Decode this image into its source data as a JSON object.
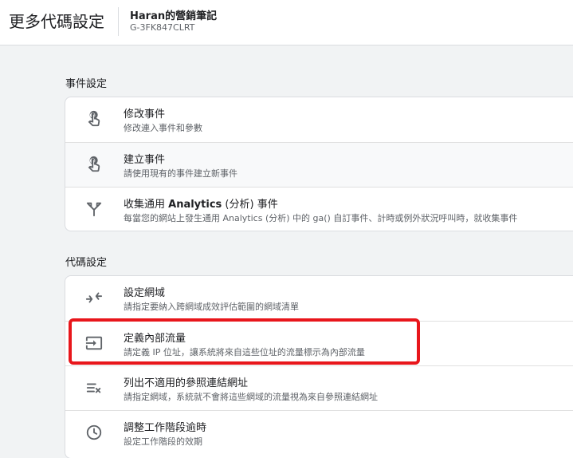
{
  "header": {
    "title": "更多代碼設定",
    "property_name": "Haran的營銷筆記",
    "property_id": "G-3FK847CLRT"
  },
  "sections": [
    {
      "title": "事件設定",
      "items": [
        {
          "title": "修改事件",
          "description": "修改連入事件和參數",
          "icon": "touch-app-icon"
        },
        {
          "title": "建立事件",
          "description": "請使用現有的事件建立新事件",
          "icon": "touch-app-icon"
        },
        {
          "title_prefix": "收集通用 ",
          "title_bold": "Analytics",
          "title_suffix": " (分析) 事件",
          "description": "每當您的網站上發生通用 Analytics (分析) 中的 ga() 自訂事件、計時或例外狀況呼叫時，就收集事件",
          "icon": "merge-icon"
        }
      ]
    },
    {
      "title": "代碼設定",
      "items": [
        {
          "title": "設定網域",
          "description": "請指定要納入跨網域成效評估範圍的網域清單",
          "icon": "compare-arrows-icon"
        },
        {
          "title": "定義內部流量",
          "description": "請定義 IP 位址，讓系統將來自這些位址的流量標示為內部流量",
          "icon": "input-icon"
        },
        {
          "title": "列出不適用的參照連結網址",
          "description": "請指定網域，系統就不會將這些網域的流量視為來自參照連結網址",
          "icon": "list-remove-icon"
        },
        {
          "title": "調整工作階段逾時",
          "description": "設定工作階段的效期",
          "icon": "clock-icon"
        }
      ]
    }
  ],
  "colors": {
    "background": "#f1f3f4",
    "card": "#ffffff",
    "highlight": "#e8161b",
    "text_primary": "#202124",
    "text_secondary": "#5f6368"
  }
}
